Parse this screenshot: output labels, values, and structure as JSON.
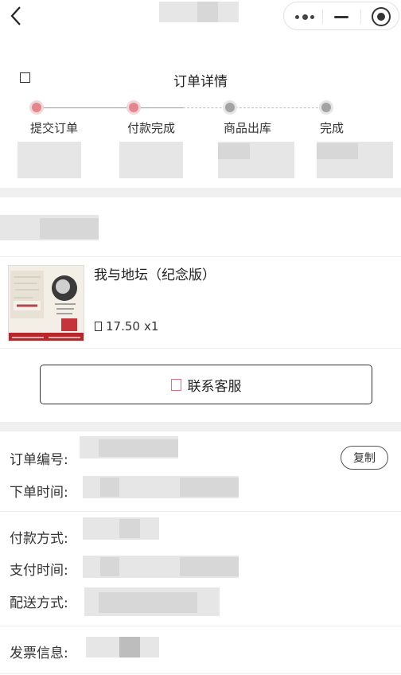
{
  "header": {
    "title": "订单详情"
  },
  "steps": [
    {
      "label": "提交订单",
      "state": "done"
    },
    {
      "label": "付款完成",
      "state": "done"
    },
    {
      "label": "商品出库",
      "state": "pending"
    },
    {
      "label": "完成",
      "state": "pending"
    }
  ],
  "product": {
    "name": "我与地坛（纪念版）",
    "price": "17.50",
    "quantity": "x1"
  },
  "contact": {
    "label": "联系客服"
  },
  "order_info": {
    "order_no_label": "订单编号:",
    "copy_label": "复制",
    "order_time_label": "下单时间:",
    "pay_method_label": "付款方式:",
    "pay_time_label": "支付时间:",
    "delivery_label": "配送方式:",
    "invoice_label": "发票信息:"
  },
  "colors": {
    "accent": "#d77f88",
    "pending": "#a3a3a3"
  }
}
